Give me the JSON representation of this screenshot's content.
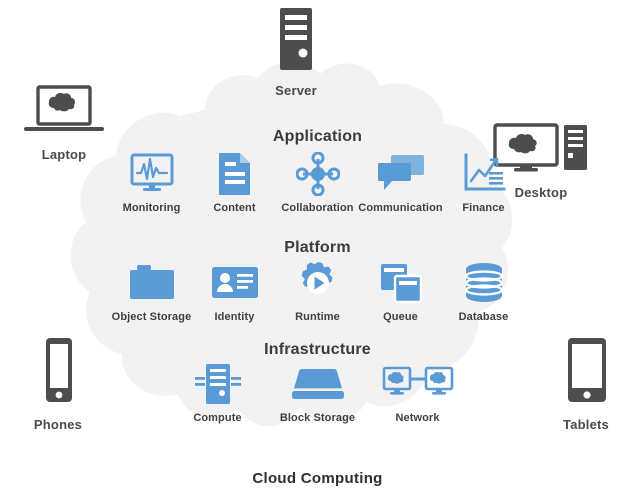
{
  "diagram": {
    "caption": "Cloud Computing",
    "cloud_color": "#f2f2f2",
    "accent_blue": "#5b9bd5",
    "device_gray": "#4d4d4d"
  },
  "devices": [
    {
      "name": "server",
      "label": "Server",
      "icon": "server-tower-icon"
    },
    {
      "name": "laptop",
      "label": "Laptop",
      "icon": "laptop-cloud-icon"
    },
    {
      "name": "desktop",
      "label": "Desktop",
      "icon": "desktop-monitor-tower-icon"
    },
    {
      "name": "phones",
      "label": "Phones",
      "icon": "smartphone-icon"
    },
    {
      "name": "tablets",
      "label": "Tablets",
      "icon": "tablet-icon"
    }
  ],
  "layers": [
    {
      "name": "application",
      "title": "Application",
      "services": [
        {
          "label": "Monitoring",
          "icon": "monitor-waveform-icon"
        },
        {
          "label": "Content",
          "icon": "document-icon"
        },
        {
          "label": "Collaboration",
          "icon": "network-nodes-icon"
        },
        {
          "label": "Communication",
          "icon": "speech-bubbles-icon"
        },
        {
          "label": "Finance",
          "icon": "line-chart-icon"
        }
      ]
    },
    {
      "name": "platform",
      "title": "Platform",
      "services": [
        {
          "label": "Object Storage",
          "icon": "folder-icon"
        },
        {
          "label": "Identity",
          "icon": "id-card-icon"
        },
        {
          "label": "Runtime",
          "icon": "gear-play-icon"
        },
        {
          "label": "Queue",
          "icon": "stacked-cards-icon"
        },
        {
          "label": "Database",
          "icon": "database-cylinder-icon"
        }
      ]
    },
    {
      "name": "infrastructure",
      "title": "Infrastructure",
      "services": [
        {
          "label": "Compute",
          "icon": "compute-tower-icon"
        },
        {
          "label": "Block Storage",
          "icon": "disk-block-icon"
        },
        {
          "label": "Network",
          "icon": "two-monitors-link-icon"
        }
      ]
    }
  ]
}
